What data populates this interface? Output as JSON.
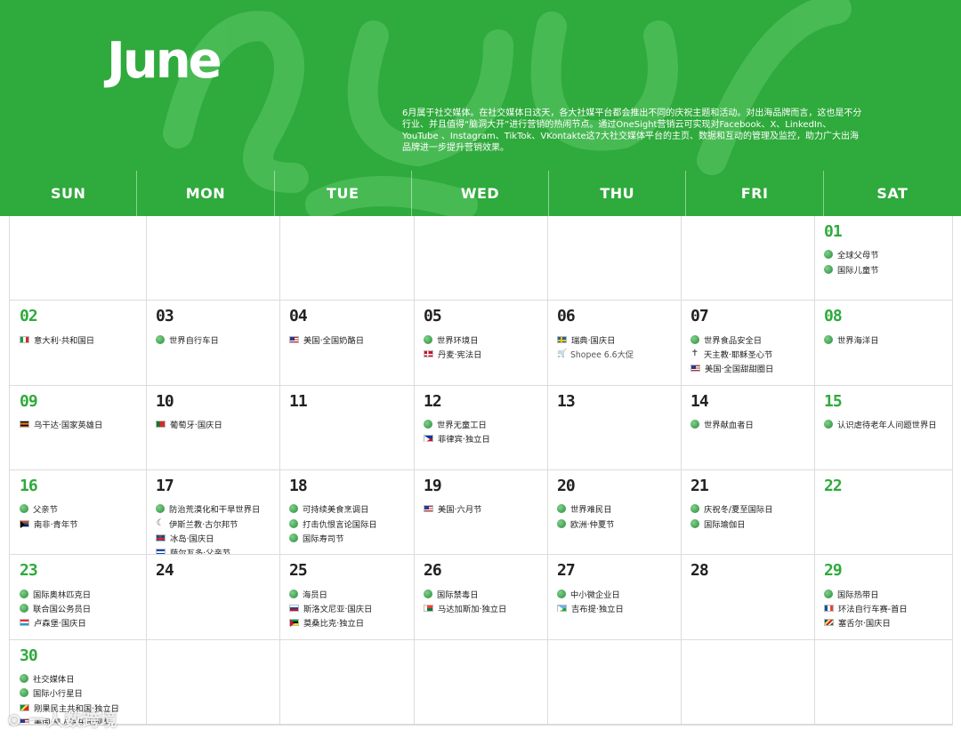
{
  "month": "June",
  "intro": "6月属于社交媒体。在社交媒体日这天，各大社媒平台都会推出不同的庆祝主题和活动。对出海品牌而言，这也是不分行业、并且值得“脑洞大开”进行营销的热闹节点。通过OneSight营销云可实现对Facebook、X、LinkedIn、YouTube 、Instagram、TikTok、VKontakte这7大社交媒体平台的主页、数据和互动的管理及监控，助力广大出海品牌进一步提升营销效果。",
  "weekdays": [
    "SUN",
    "MON",
    "TUE",
    "WED",
    "THU",
    "FRI",
    "SAT"
  ],
  "colors": {
    "brand_green": "#2faa3c",
    "grid_line": "#dcdcdc"
  },
  "watermark": "⊙ 一人数跨境",
  "weeks": [
    [
      {
        "day": "",
        "events": []
      },
      {
        "day": "",
        "events": []
      },
      {
        "day": "",
        "events": []
      },
      {
        "day": "",
        "events": []
      },
      {
        "day": "",
        "events": []
      },
      {
        "day": "",
        "events": []
      },
      {
        "day": "01",
        "events": [
          {
            "icon": "globe",
            "text": "全球父母节"
          },
          {
            "icon": "globe",
            "text": "国际儿童节"
          }
        ]
      }
    ],
    [
      {
        "day": "02",
        "events": [
          {
            "icon": "flag it",
            "text": "意大利·共和国日"
          }
        ]
      },
      {
        "day": "03",
        "events": [
          {
            "icon": "globe",
            "text": "世界自行车日"
          }
        ]
      },
      {
        "day": "04",
        "events": [
          {
            "icon": "flag us",
            "text": "美国·全国奶酪日"
          }
        ]
      },
      {
        "day": "05",
        "events": [
          {
            "icon": "globe",
            "text": "世界环境日"
          },
          {
            "icon": "flag dk",
            "text": "丹麦·宪法日"
          }
        ]
      },
      {
        "day": "06",
        "events": [
          {
            "icon": "flag se",
            "text": "瑞典·国庆日"
          },
          {
            "icon": "cart",
            "text": "Shopee 6.6大促"
          }
        ]
      },
      {
        "day": "07",
        "events": [
          {
            "icon": "globe",
            "text": "世界食品安全日"
          },
          {
            "icon": "cross",
            "text": "天主教·耶稣圣心节"
          },
          {
            "icon": "flag us",
            "text": "美国·全国甜甜圈日"
          }
        ]
      },
      {
        "day": "08",
        "events": [
          {
            "icon": "globe",
            "text": "世界海洋日"
          }
        ]
      }
    ],
    [
      {
        "day": "09",
        "events": [
          {
            "icon": "flag ug",
            "text": "乌干达·国家英雄日"
          }
        ]
      },
      {
        "day": "10",
        "events": [
          {
            "icon": "flag pt",
            "text": "葡萄牙·国庆日"
          }
        ]
      },
      {
        "day": "11",
        "events": []
      },
      {
        "day": "12",
        "events": [
          {
            "icon": "globe",
            "text": "世界无童工日"
          },
          {
            "icon": "flag ph",
            "text": "菲律宾·独立日"
          }
        ]
      },
      {
        "day": "13",
        "events": []
      },
      {
        "day": "14",
        "events": [
          {
            "icon": "globe",
            "text": "世界献血者日"
          }
        ]
      },
      {
        "day": "15",
        "events": [
          {
            "icon": "globe",
            "text": "认识虐待老年人问题世界日"
          }
        ]
      }
    ],
    [
      {
        "day": "16",
        "events": [
          {
            "icon": "globe",
            "text": "父亲节"
          },
          {
            "icon": "flag za",
            "text": "南非·青年节"
          }
        ]
      },
      {
        "day": "17",
        "events": [
          {
            "icon": "globe",
            "text": "防治荒漠化和干旱世界日"
          },
          {
            "icon": "moon",
            "text": "伊斯兰教·古尔邦节"
          },
          {
            "icon": "flag is",
            "text": "冰岛·国庆日"
          },
          {
            "icon": "flag sv",
            "text": "萨尔瓦多·父亲节"
          }
        ]
      },
      {
        "day": "18",
        "events": [
          {
            "icon": "globe",
            "text": "可持续美食烹调日"
          },
          {
            "icon": "globe",
            "text": "打击仇恨言论国际日"
          },
          {
            "icon": "globe",
            "text": "国际寿司节"
          }
        ]
      },
      {
        "day": "19",
        "events": [
          {
            "icon": "flag us",
            "text": "美国·六月节"
          }
        ]
      },
      {
        "day": "20",
        "events": [
          {
            "icon": "globe",
            "text": "世界难民日"
          },
          {
            "icon": "globe",
            "text": "欧洲·仲夏节"
          }
        ]
      },
      {
        "day": "21",
        "events": [
          {
            "icon": "globe",
            "text": "庆祝冬/夏至国际日"
          },
          {
            "icon": "globe",
            "text": "国际瑜伽日"
          }
        ]
      },
      {
        "day": "22",
        "events": []
      }
    ],
    [
      {
        "day": "23",
        "events": [
          {
            "icon": "globe",
            "text": "国际奥林匹克日"
          },
          {
            "icon": "globe",
            "text": "联合国公务员日"
          },
          {
            "icon": "flag lu",
            "text": "卢森堡·国庆日"
          }
        ]
      },
      {
        "day": "24",
        "events": []
      },
      {
        "day": "25",
        "events": [
          {
            "icon": "globe",
            "text": "海员日"
          },
          {
            "icon": "flag si",
            "text": "斯洛文尼亚·国庆日"
          },
          {
            "icon": "flag mz",
            "text": "莫桑比克·独立日"
          }
        ]
      },
      {
        "day": "26",
        "events": [
          {
            "icon": "globe",
            "text": "国际禁毒日"
          },
          {
            "icon": "flag mg",
            "text": "马达加斯加·独立日"
          }
        ]
      },
      {
        "day": "27",
        "events": [
          {
            "icon": "globe",
            "text": "中小微企业日"
          },
          {
            "icon": "flag dj",
            "text": "吉布提·独立日"
          }
        ]
      },
      {
        "day": "28",
        "events": []
      },
      {
        "day": "29",
        "events": [
          {
            "icon": "globe",
            "text": "国际热带日"
          },
          {
            "icon": "flag fr",
            "text": "环法自行车赛-首日"
          },
          {
            "icon": "flag sc",
            "text": "塞舌尔·国庆日"
          }
        ]
      }
    ],
    [
      {
        "day": "30",
        "events": [
          {
            "icon": "globe",
            "text": "社交媒体日"
          },
          {
            "icon": "globe",
            "text": "国际小行星日"
          },
          {
            "icon": "flag cg",
            "text": "刚果民主共和国·独立日"
          },
          {
            "icon": "flag us",
            "text": "美国·黑人娱乐电视奖"
          }
        ]
      },
      {
        "day": "",
        "events": []
      },
      {
        "day": "",
        "events": []
      },
      {
        "day": "",
        "events": []
      },
      {
        "day": "",
        "events": []
      },
      {
        "day": "",
        "events": []
      },
      {
        "day": "",
        "events": []
      }
    ]
  ]
}
